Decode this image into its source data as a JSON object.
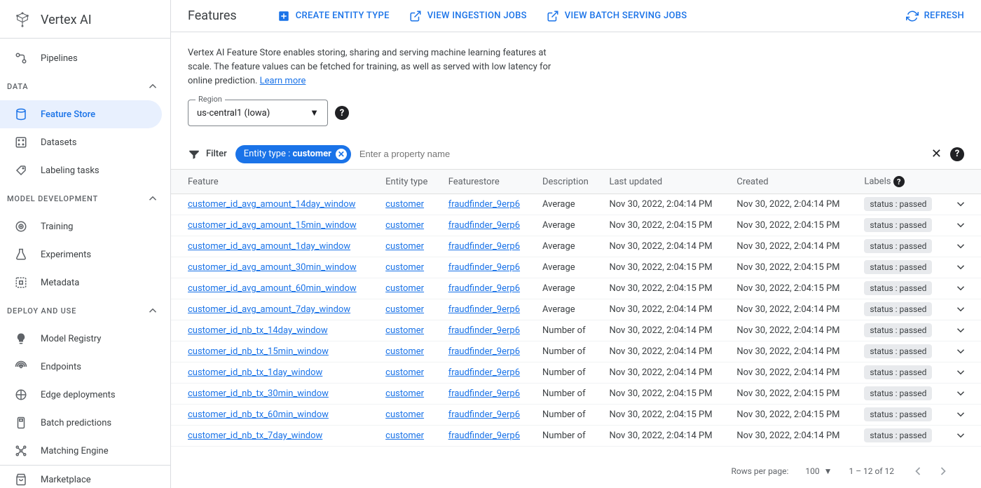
{
  "product": "Vertex AI",
  "sidebar": {
    "top_item": "Pipelines",
    "sections": [
      {
        "label": "DATA",
        "items": [
          "Feature Store",
          "Datasets",
          "Labeling tasks"
        ],
        "selected": 0
      },
      {
        "label": "MODEL DEVELOPMENT",
        "items": [
          "Training",
          "Experiments",
          "Metadata"
        ],
        "selected": -1
      },
      {
        "label": "DEPLOY AND USE",
        "items": [
          "Model Registry",
          "Endpoints",
          "Edge deployments",
          "Batch predictions",
          "Matching Engine"
        ],
        "selected": -1
      }
    ],
    "footer_item": "Marketplace"
  },
  "header": {
    "title": "Features",
    "actions": [
      "Create entity type",
      "View ingestion jobs",
      "View batch serving jobs"
    ],
    "refresh": "Refresh"
  },
  "intro": {
    "text": "Vertex AI Feature Store enables storing, sharing and serving machine learning features at scale. The feature values can be fetched for training, as well as served with low latency for online prediction. ",
    "learn_more": "Learn more"
  },
  "region": {
    "label": "Region",
    "value": "us-central1 (Iowa)"
  },
  "filter": {
    "label": "Filter",
    "chip_key": "Entity type",
    "chip_val": "customer",
    "placeholder": "Enter a property name"
  },
  "table": {
    "columns": [
      "Feature",
      "Entity type",
      "Featurestore",
      "Description",
      "Last updated",
      "Created",
      "Labels"
    ],
    "rows": [
      {
        "feature": "customer_id_avg_amount_14day_window",
        "entity": "customer",
        "store": "fraudfinder_9erp6",
        "desc": "Average",
        "updated": "Nov 30, 2022, 2:04:14 PM",
        "created": "Nov 30, 2022, 2:04:14 PM",
        "label": "status : passed"
      },
      {
        "feature": "customer_id_avg_amount_15min_window",
        "entity": "customer",
        "store": "fraudfinder_9erp6",
        "desc": "Average",
        "updated": "Nov 30, 2022, 2:04:15 PM",
        "created": "Nov 30, 2022, 2:04:15 PM",
        "label": "status : passed"
      },
      {
        "feature": "customer_id_avg_amount_1day_window",
        "entity": "customer",
        "store": "fraudfinder_9erp6",
        "desc": "Average",
        "updated": "Nov 30, 2022, 2:04:14 PM",
        "created": "Nov 30, 2022, 2:04:14 PM",
        "label": "status : passed"
      },
      {
        "feature": "customer_id_avg_amount_30min_window",
        "entity": "customer",
        "store": "fraudfinder_9erp6",
        "desc": "Average",
        "updated": "Nov 30, 2022, 2:04:15 PM",
        "created": "Nov 30, 2022, 2:04:15 PM",
        "label": "status : passed"
      },
      {
        "feature": "customer_id_avg_amount_60min_window",
        "entity": "customer",
        "store": "fraudfinder_9erp6",
        "desc": "Average",
        "updated": "Nov 30, 2022, 2:04:15 PM",
        "created": "Nov 30, 2022, 2:04:15 PM",
        "label": "status : passed"
      },
      {
        "feature": "customer_id_avg_amount_7day_window",
        "entity": "customer",
        "store": "fraudfinder_9erp6",
        "desc": "Average",
        "updated": "Nov 30, 2022, 2:04:14 PM",
        "created": "Nov 30, 2022, 2:04:14 PM",
        "label": "status : passed"
      },
      {
        "feature": "customer_id_nb_tx_14day_window",
        "entity": "customer",
        "store": "fraudfinder_9erp6",
        "desc": "Number of",
        "updated": "Nov 30, 2022, 2:04:14 PM",
        "created": "Nov 30, 2022, 2:04:14 PM",
        "label": "status : passed"
      },
      {
        "feature": "customer_id_nb_tx_15min_window",
        "entity": "customer",
        "store": "fraudfinder_9erp6",
        "desc": "Number of",
        "updated": "Nov 30, 2022, 2:04:14 PM",
        "created": "Nov 30, 2022, 2:04:14 PM",
        "label": "status : passed"
      },
      {
        "feature": "customer_id_nb_tx_1day_window",
        "entity": "customer",
        "store": "fraudfinder_9erp6",
        "desc": "Number of",
        "updated": "Nov 30, 2022, 2:04:14 PM",
        "created": "Nov 30, 2022, 2:04:14 PM",
        "label": "status : passed"
      },
      {
        "feature": "customer_id_nb_tx_30min_window",
        "entity": "customer",
        "store": "fraudfinder_9erp6",
        "desc": "Number of",
        "updated": "Nov 30, 2022, 2:04:15 PM",
        "created": "Nov 30, 2022, 2:04:15 PM",
        "label": "status : passed"
      },
      {
        "feature": "customer_id_nb_tx_60min_window",
        "entity": "customer",
        "store": "fraudfinder_9erp6",
        "desc": "Number of",
        "updated": "Nov 30, 2022, 2:04:15 PM",
        "created": "Nov 30, 2022, 2:04:15 PM",
        "label": "status : passed"
      },
      {
        "feature": "customer_id_nb_tx_7day_window",
        "entity": "customer",
        "store": "fraudfinder_9erp6",
        "desc": "Number of",
        "updated": "Nov 30, 2022, 2:04:14 PM",
        "created": "Nov 30, 2022, 2:04:14 PM",
        "label": "status : passed"
      }
    ]
  },
  "pagination": {
    "rows_label": "Rows per page:",
    "rows_value": "100",
    "range": "1 – 12 of 12"
  }
}
